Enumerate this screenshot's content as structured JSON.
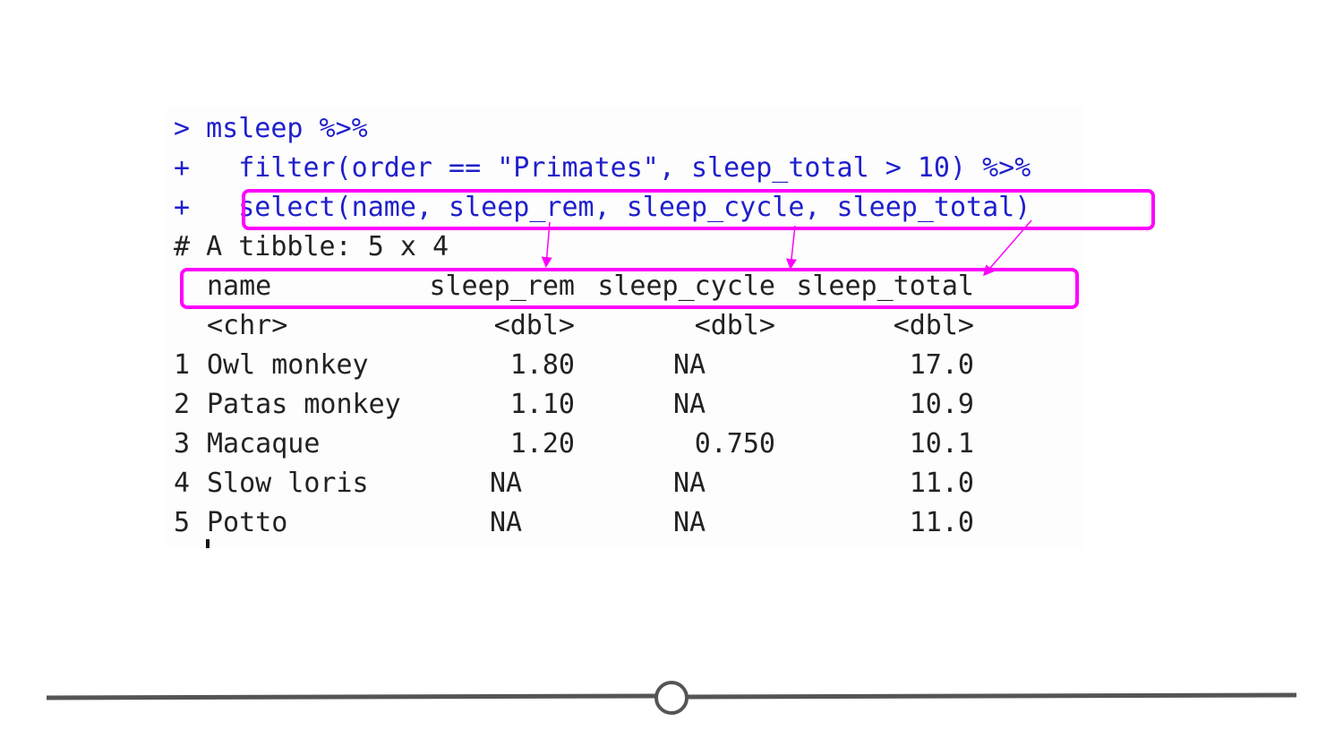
{
  "console": {
    "prompt_lines": [
      {
        "prefix": ">",
        "code": " msleep %>%"
      },
      {
        "prefix": "+",
        "code": "   filter(order == \"Primates\", sleep_total > 10) %>%"
      },
      {
        "prefix": "+",
        "code": "   select(name, sleep_rem, sleep_cycle, sleep_total)"
      }
    ],
    "tibble_comment": "# A tibble: 5 x 4",
    "columns": [
      {
        "name": "name",
        "type": "<chr>"
      },
      {
        "name": "sleep_rem",
        "type": "<dbl>"
      },
      {
        "name": "sleep_cycle",
        "type": "<dbl>"
      },
      {
        "name": "sleep_total",
        "type": "<dbl>"
      }
    ],
    "rows": [
      {
        "idx": "1",
        "name": "Owl monkey",
        "sleep_rem": "1.80",
        "sleep_cycle": "NA",
        "sleep_total": "17.0"
      },
      {
        "idx": "2",
        "name": "Patas monkey",
        "sleep_rem": "1.10",
        "sleep_cycle": "NA",
        "sleep_total": "10.9"
      },
      {
        "idx": "3",
        "name": "Macaque",
        "sleep_rem": "1.20",
        "sleep_cycle": "0.750",
        "sleep_total": "10.1"
      },
      {
        "idx": "4",
        "name": "Slow loris",
        "sleep_rem": "NA",
        "sleep_cycle": "NA",
        "sleep_total": "11.0"
      },
      {
        "idx": "5",
        "name": "Potto",
        "sleep_rem": "NA",
        "sleep_cycle": "NA",
        "sleep_total": "11.0"
      }
    ]
  },
  "colors": {
    "code": "#1f1fcc",
    "highlight": "#ff00ff",
    "slider": "#555555"
  },
  "icons": {
    "slider_handle": "circle-handle-icon"
  }
}
